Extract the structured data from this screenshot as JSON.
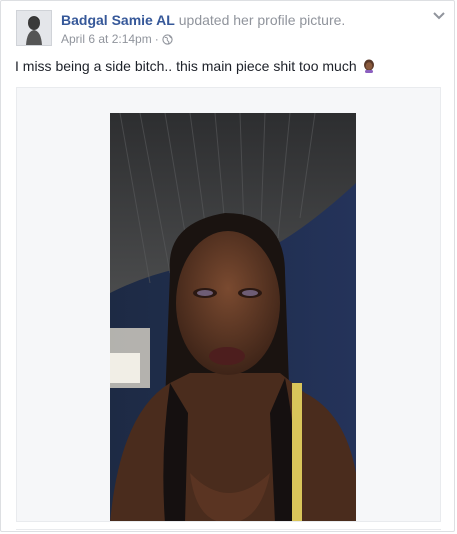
{
  "post": {
    "author": "Badgal Samie AL",
    "action": "updated her profile picture.",
    "timestamp": "April 6 at 2:14pm",
    "separator": "·",
    "privacy_icon": "globe-icon",
    "text": "I miss being a side bitch.. this main piece shit too much",
    "emoji": "woman-emoji",
    "menu_icon": "chevron-down-icon",
    "photo_description_icon": "profile-photo"
  },
  "colors": {
    "author_link": "#365899",
    "meta_gray": "#90949c",
    "body_text": "#1d2129",
    "card_border": "#dddfe2"
  }
}
